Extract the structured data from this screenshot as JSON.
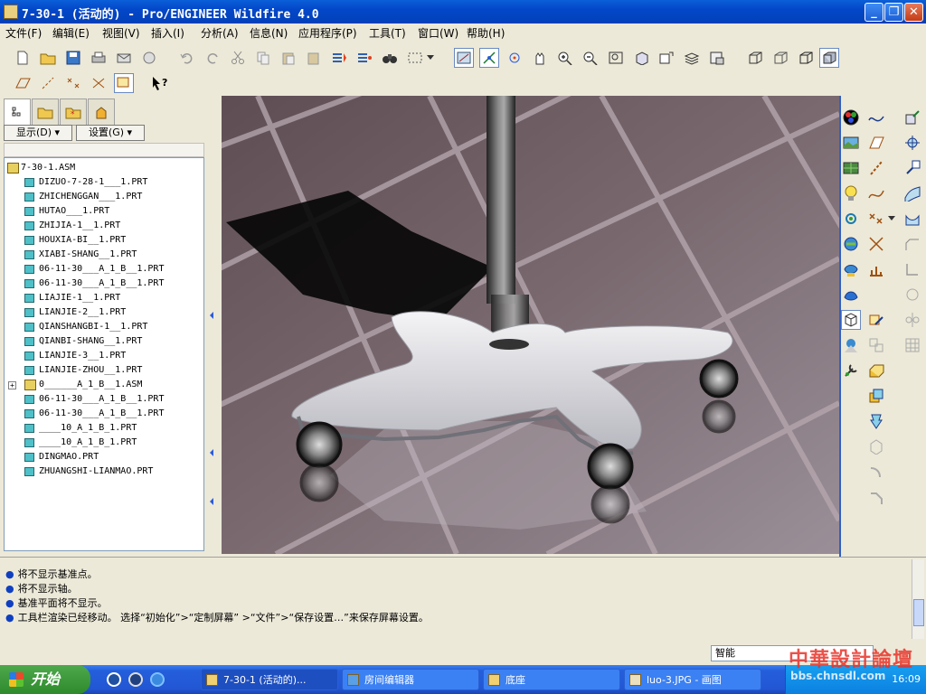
{
  "window": {
    "title": "7-30-1 (活动的) - Pro/ENGINEER Wildfire 4.0"
  },
  "menu": [
    "文件(F)",
    "编辑(E)",
    "视图(V)",
    "插入(I)",
    "分析(A)",
    "信息(N)",
    "应用程序(P)",
    "工具(T)",
    "窗口(W)",
    "帮助(H)"
  ],
  "panel": {
    "show_label": "显示(D) ▾",
    "settings_label": "设置(G) ▾"
  },
  "tree": {
    "root": "7-30-1.ASM",
    "items": [
      "DIZUO-7-28-1___1.PRT",
      "ZHICHENGGAN___1.PRT",
      "HUTAO___1.PRT",
      "ZHIJIA-1__1.PRT",
      "HOUXIA-BI__1.PRT",
      "XIABI-SHANG__1.PRT",
      "06-11-30___A_1_B__1.PRT",
      "06-11-30___A_1_B__1.PRT",
      "LIAJIE-1__1.PRT",
      "LIANJIE-2__1.PRT",
      "QIANSHANGBI-1__1.PRT",
      "QIANBI-SHANG__1.PRT",
      "LIANJIE-3__1.PRT",
      "LIANJIE-ZHOU__1.PRT",
      "0______A_1_B__1.ASM",
      "06-11-30___A_1_B__1.PRT",
      "06-11-30___A_1_B__1.PRT",
      "____10_A_1_B_1.PRT",
      "____10_A_1_B_1.PRT",
      "DINGMAO.PRT",
      "ZHUANGSHI-LIANMAO.PRT"
    ]
  },
  "messages": [
    "将不显示基准点。",
    "将不显示轴。",
    "基准平面将不显示。",
    "工具栏渲染已经移动。  选择“初始化”>“定制屏幕”  >“文件”>“保存设置…”来保存屏幕设置。"
  ],
  "status": {
    "filter": "智能"
  },
  "taskbar": {
    "start": "开始",
    "tasks": [
      "7-30-1 (活动的)...",
      "房间编辑器",
      "底座",
      "luo-3.JPG - 画图"
    ],
    "clock": "16:09"
  },
  "watermark": {
    "text": "中華設計論壇",
    "url": "bbs.chnsdl.com"
  }
}
